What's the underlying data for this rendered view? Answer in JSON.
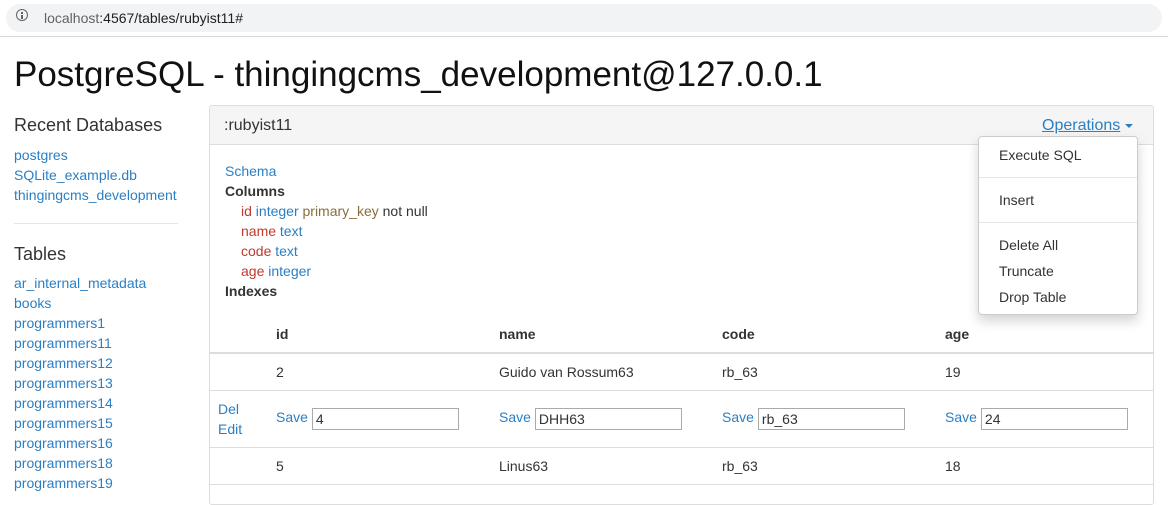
{
  "browser": {
    "url_host": "localhost",
    "url_path": ":4567/tables/rubyist11#"
  },
  "page_title": "PostgreSQL - thingingcms_development@127.0.0.1",
  "sidebar": {
    "recent_heading": "Recent Databases",
    "databases": [
      "postgres",
      "SQLite_example.db",
      "thingingcms_development"
    ],
    "tables_heading": "Tables",
    "tables": [
      "ar_internal_metadata",
      "books",
      "programmers1",
      "programmers11",
      "programmers12",
      "programmers13",
      "programmers14",
      "programmers15",
      "programmers16",
      "programmers18",
      "programmers19"
    ]
  },
  "panel": {
    "title": ":rubyist11",
    "operations_label": "Operations",
    "schema_link": "Schema",
    "columns_label": "Columns",
    "columns": [
      {
        "name": "id",
        "type": "integer",
        "key": "primary_key",
        "null": "not null"
      },
      {
        "name": "name",
        "type": "text",
        "key": "",
        "null": ""
      },
      {
        "name": "code",
        "type": "text",
        "key": "",
        "null": ""
      },
      {
        "name": "age",
        "type": "integer",
        "key": "",
        "null": ""
      }
    ],
    "indexes_label": "Indexes"
  },
  "table": {
    "headers": [
      "id",
      "name",
      "code",
      "age"
    ],
    "row1": [
      "2",
      "Guido van Rossum63",
      "rb_63",
      "19"
    ],
    "edit_row": {
      "del_label": "Del",
      "edit_label": "Edit",
      "save_label": "Save",
      "values": [
        "4",
        "DHH63",
        "rb_63",
        "24"
      ]
    },
    "row3": [
      "5",
      "Linus63",
      "rb_63",
      "18"
    ]
  },
  "operations_menu": {
    "execute_sql": "Execute SQL",
    "insert": "Insert",
    "delete_all": "Delete All",
    "truncate": "Truncate",
    "drop_table": "Drop Table"
  }
}
